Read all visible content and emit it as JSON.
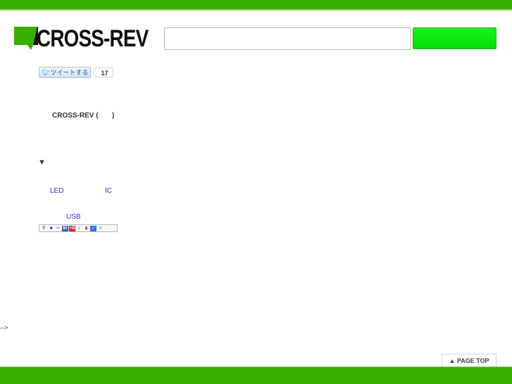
{
  "header": {
    "logo_text": "CROSS-REV",
    "search_input_value": "",
    "search_input_placeholder": "",
    "search_button_label": ""
  },
  "social": {
    "tweet_button_label": "ツイートする",
    "tweet_count": "17"
  },
  "content": {
    "site_line": "CROSS-REV (       )",
    "section_marker": "▼",
    "links": {
      "led": "LED",
      "ic": "IC",
      "usb": "USB"
    },
    "comment_residue": "-->"
  },
  "share_icons": [
    {
      "name": "pinboard-icon",
      "glyph": "P",
      "color": "#2a9a2a",
      "bg": "#f7f7f7"
    },
    {
      "name": "delicious-icon",
      "glyph": "■",
      "color": "#1a1a8a",
      "bg": "#f7f7f7"
    },
    {
      "name": "livedoor-clip-icon",
      "glyph": "✂",
      "color": "#c03030",
      "bg": "#f7f7f7"
    },
    {
      "name": "hatena-bookmark-icon",
      "glyph": "B!",
      "color": "#ffffff",
      "bg": "#3060b8"
    },
    {
      "name": "buzzurl-icon",
      "glyph": "+B",
      "color": "#ffffff",
      "bg": "#d02020"
    },
    {
      "name": "clip-icon",
      "glyph": "∕",
      "color": "#3070d0",
      "bg": "#f7f7f7"
    },
    {
      "name": "bookmark-red-icon",
      "glyph": "▮",
      "color": "#d02020",
      "bg": "#f7f7f7"
    },
    {
      "name": "check-icon",
      "glyph": "✓",
      "color": "#ffffff",
      "bg": "#2a78d0"
    },
    {
      "name": "gear-icon",
      "glyph": "✲",
      "color": "#999999",
      "bg": "#f7f7f7"
    }
  ],
  "footer": {
    "page_top_label": "▲ PAGE TOP",
    "copyright": ""
  },
  "colors": {
    "brand_green": "#3aae00",
    "search_button_green": "#12e612",
    "link_blue": "#3333cc"
  }
}
